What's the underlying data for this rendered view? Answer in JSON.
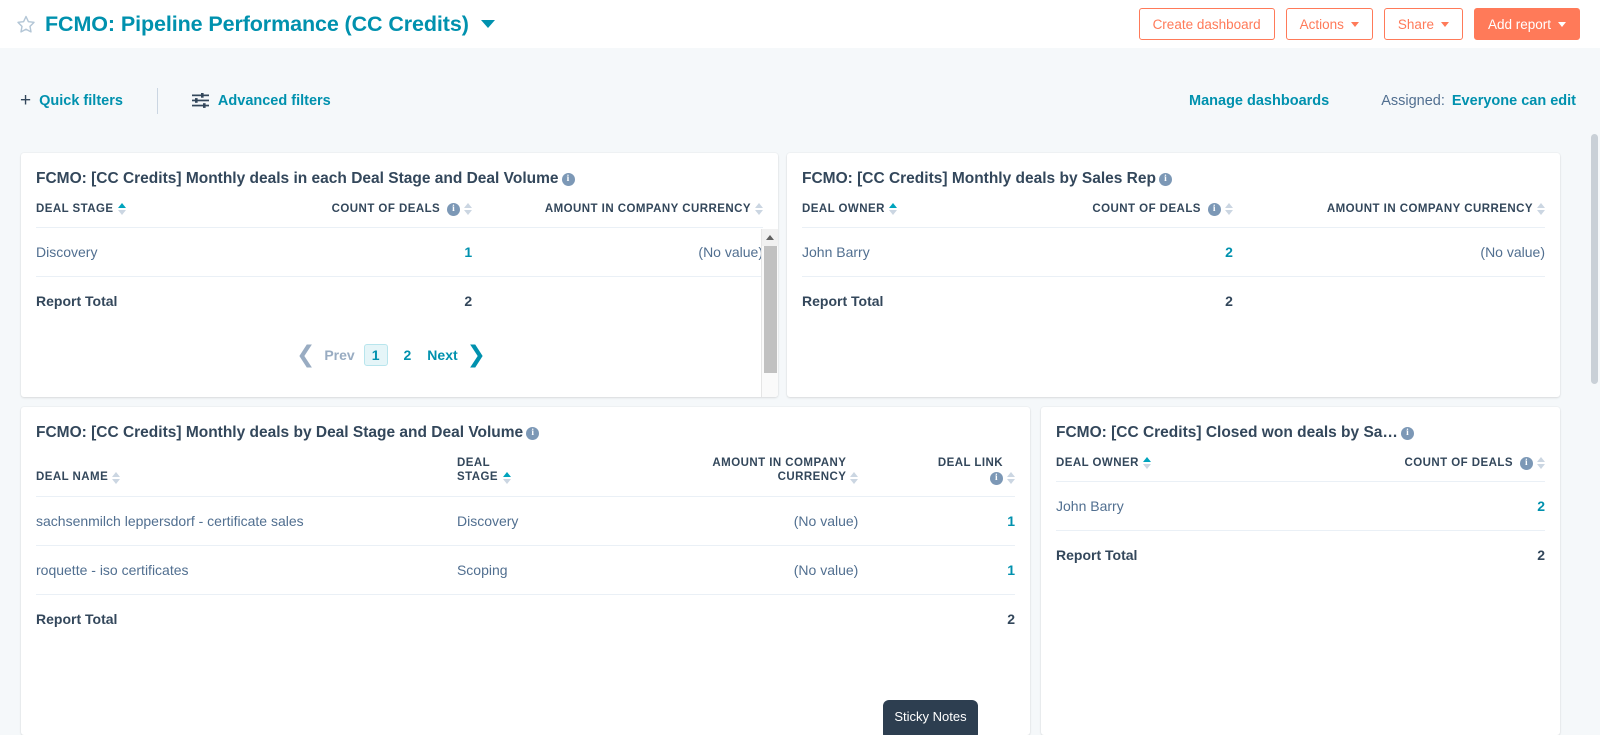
{
  "header": {
    "star_icon": "star-outline-icon",
    "title": "FCMO: Pipeline Performance (CC Credits)",
    "title_caret": "chevron-down-icon",
    "buttons": {
      "create_dashboard": "Create dashboard",
      "actions": "Actions",
      "share": "Share",
      "add_report": "Add report"
    }
  },
  "filters": {
    "quick_filters": "Quick filters",
    "advanced_filters": "Advanced filters",
    "manage_dashboards": "Manage dashboards",
    "assigned_label": "Assigned:",
    "assigned_value": "Everyone can edit"
  },
  "colors": {
    "accent_orange": "#ff7a59",
    "teal": "#0091ae",
    "dark_blue": "#33475b",
    "page_bg": "#f5f8fa"
  },
  "cards": [
    {
      "title": "FCMO: [CC Credits] Monthly deals in each Deal Stage and Deal Volume",
      "columns": [
        "DEAL STAGE",
        "COUNT OF DEALS",
        "AMOUNT IN COMPANY CURRENCY"
      ],
      "rows": [
        {
          "stage": "Discovery",
          "count": "1",
          "amount": "(No value)"
        }
      ],
      "total_label": "Report Total",
      "total_count": "2",
      "pagination": {
        "prev": "Prev",
        "pages": [
          "1",
          "2"
        ],
        "current": "1",
        "next": "Next"
      }
    },
    {
      "title": "FCMO: [CC Credits] Monthly deals by Sales Rep",
      "columns": [
        "DEAL OWNER",
        "COUNT OF DEALS",
        "AMOUNT IN COMPANY CURRENCY"
      ],
      "rows": [
        {
          "owner": "John Barry",
          "count": "2",
          "amount": "(No value)"
        }
      ],
      "total_label": "Report Total",
      "total_count": "2"
    },
    {
      "title": "FCMO: [CC Credits] Monthly deals by Deal Stage and Deal Volume",
      "columns": [
        "DEAL NAME",
        "DEAL STAGE",
        "AMOUNT IN COMPANY CURRENCY",
        "DEAL LINK"
      ],
      "rows": [
        {
          "name": "sachsenmilch leppersdorf - certificate sales",
          "stage": "Discovery",
          "amount": "(No value)",
          "link": "1"
        },
        {
          "name": "roquette - iso certificates",
          "stage": "Scoping",
          "amount": "(No value)",
          "link": "1"
        }
      ],
      "total_label": "Report Total",
      "total_link": "2"
    },
    {
      "title": "FCMO: [CC Credits] Closed won deals by Sa…",
      "columns": [
        "DEAL OWNER",
        "COUNT OF DEALS"
      ],
      "rows": [
        {
          "owner": "John Barry",
          "count": "2"
        }
      ],
      "total_label": "Report Total",
      "total_count": "2"
    }
  ],
  "sticky_notes": {
    "label": "Sticky Notes"
  }
}
